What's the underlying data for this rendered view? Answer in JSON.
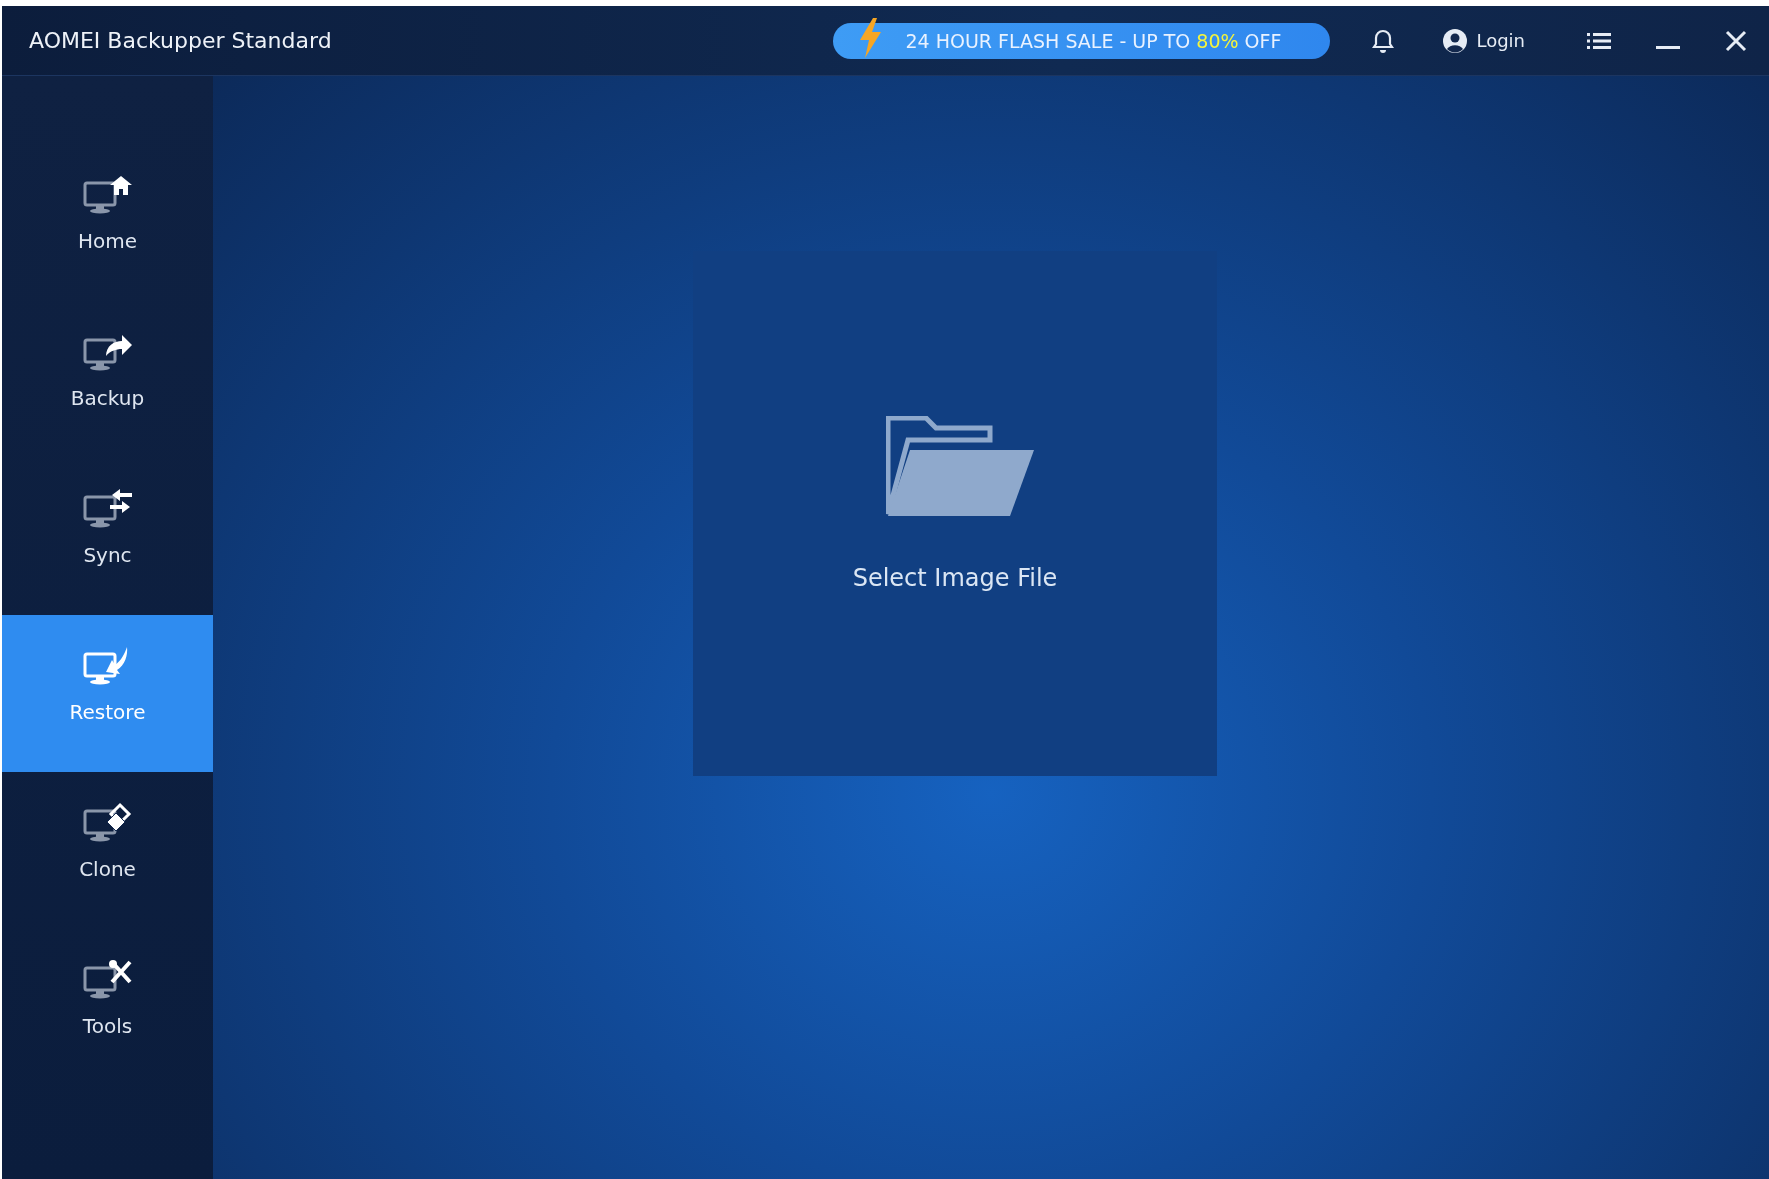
{
  "window": {
    "title": "AOMEI Backupper Standard"
  },
  "promo": {
    "lead": "24 HOUR FLASH SALE - UP TO ",
    "highlight": "80%",
    "tail": " OFF"
  },
  "account": {
    "label": "Login"
  },
  "sidebar": {
    "items": [
      {
        "label": "Home",
        "selected": false
      },
      {
        "label": "Backup",
        "selected": false
      },
      {
        "label": "Sync",
        "selected": false
      },
      {
        "label": "Restore",
        "selected": true
      },
      {
        "label": "Clone",
        "selected": false
      },
      {
        "label": "Tools",
        "selected": false
      }
    ]
  },
  "main": {
    "select_label": "Select Image File"
  }
}
